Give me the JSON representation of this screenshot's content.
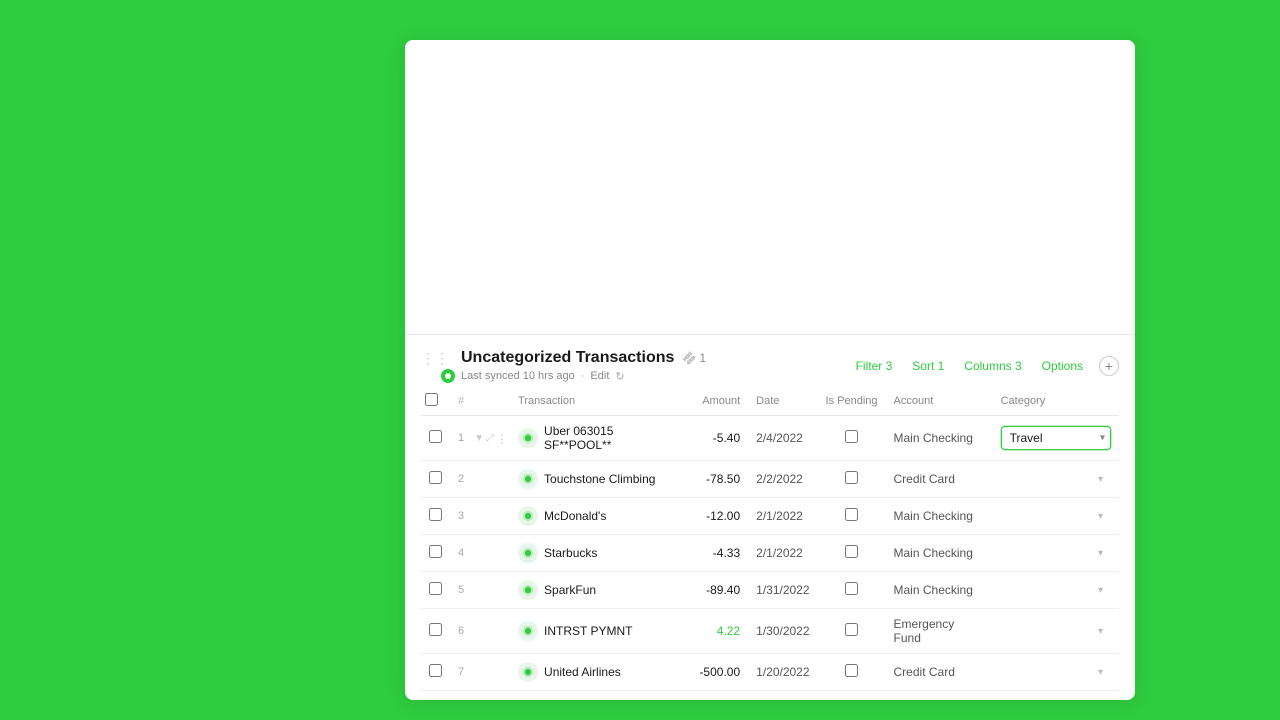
{
  "page": {
    "background": "#2ecc40"
  },
  "section": {
    "title": "Uncategorized Transactions",
    "link_badge": "1",
    "sync_text": "Last synced 10 hrs ago",
    "edit_label": "Edit",
    "filter_label": "Filter 3",
    "sort_label": "Sort 1",
    "columns_label": "Columns 3",
    "options_label": "Options"
  },
  "table": {
    "headers": [
      "",
      "",
      "",
      "Transaction",
      "Amount",
      "Date",
      "Is Pending",
      "Account",
      "Category"
    ],
    "rows": [
      {
        "num": 1,
        "merchant": "Uber 063015 SF**POOL**",
        "amount": "-5.40",
        "date": "2/4/2022",
        "is_pending": false,
        "account": "Main Checking",
        "category": "Travel",
        "category_active": true
      },
      {
        "num": 2,
        "merchant": "Touchstone Climbing",
        "amount": "-78.50",
        "date": "2/2/2022",
        "is_pending": false,
        "account": "Credit Card",
        "category": "",
        "category_active": false
      },
      {
        "num": 3,
        "merchant": "McDonald's",
        "amount": "-12.00",
        "date": "2/1/2022",
        "is_pending": false,
        "account": "Main Checking",
        "category": "",
        "category_active": false
      },
      {
        "num": 4,
        "merchant": "Starbucks",
        "amount": "-4.33",
        "date": "2/1/2022",
        "is_pending": false,
        "account": "Main Checking",
        "category": "",
        "category_active": false
      },
      {
        "num": 5,
        "merchant": "SparkFun",
        "amount": "-89.40",
        "date": "1/31/2022",
        "is_pending": false,
        "account": "Main Checking",
        "category": "",
        "category_active": false
      },
      {
        "num": 6,
        "merchant": "INTRST PYMNT",
        "amount": "4.22",
        "date": "1/30/2022",
        "is_pending": false,
        "account": "Emergency Fund",
        "category": "",
        "category_active": false
      },
      {
        "num": 7,
        "merchant": "United Airlines",
        "amount": "-500.00",
        "date": "1/20/2022",
        "is_pending": false,
        "account": "Credit Card",
        "category": "",
        "category_active": false
      }
    ]
  }
}
